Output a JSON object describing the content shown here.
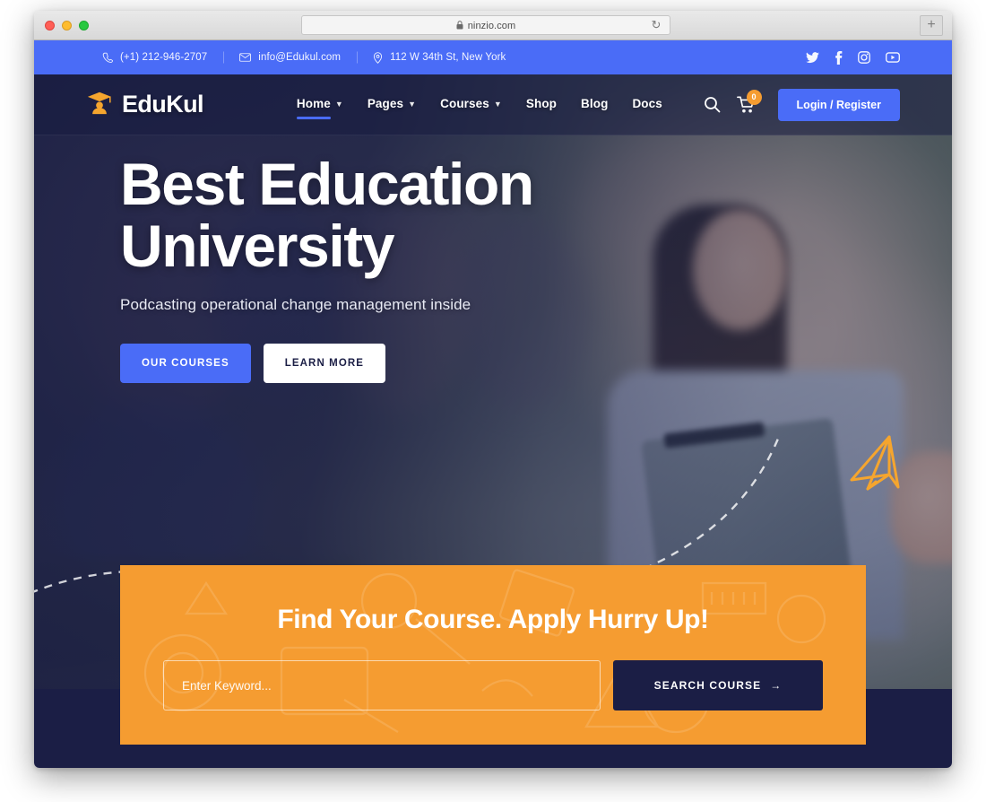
{
  "browser": {
    "url": "ninzio.com",
    "lock_icon": "lock-icon",
    "reload_icon": "reload-icon",
    "newtab_label": "+",
    "sidebar_icon": "sidebar-toggle-icon"
  },
  "topbar": {
    "contacts": [
      {
        "icon": "phone-icon",
        "text": "(+1) 212-946-2707"
      },
      {
        "icon": "envelope-icon",
        "text": "info@Edukul.com"
      },
      {
        "icon": "location-pin-icon",
        "text": "112 W 34th St, New York"
      }
    ],
    "socials": [
      {
        "icon": "twitter-icon",
        "name": "Twitter"
      },
      {
        "icon": "facebook-icon",
        "name": "Facebook"
      },
      {
        "icon": "instagram-icon",
        "name": "Instagram"
      },
      {
        "icon": "youtube-icon",
        "name": "YouTube"
      }
    ],
    "background": "#4a6cf7"
  },
  "header": {
    "logo": {
      "text": "EduKul",
      "icon": "graduation-cap-icon"
    },
    "nav": [
      {
        "label": "Home",
        "has_caret": true,
        "active": true
      },
      {
        "label": "Pages",
        "has_caret": true,
        "active": false
      },
      {
        "label": "Courses",
        "has_caret": true,
        "active": false
      },
      {
        "label": "Shop",
        "has_caret": false,
        "active": false
      },
      {
        "label": "Blog",
        "has_caret": false,
        "active": false
      },
      {
        "label": "Docs",
        "has_caret": false,
        "active": false
      }
    ],
    "search_icon": "search-icon",
    "cart_icon": "shopping-cart-icon",
    "cart_count": "0",
    "login_label": "Login / Register",
    "accent": "#4a6cf7"
  },
  "hero": {
    "title": "Best Education\nUniversity",
    "subtitle": "Podcasting operational change management inside",
    "primary_button": "OUR COURSES",
    "secondary_button": "LEARN MORE",
    "decoration": "paper-plane-icon"
  },
  "search_panel": {
    "heading": "Find Your Course. Apply Hurry Up!",
    "input_placeholder": "Enter Keyword...",
    "input_value": "",
    "button_label": "SEARCH COURSE",
    "button_icon": "arrow-right-icon",
    "background": "#f59c31",
    "button_background": "#1b1e45"
  }
}
